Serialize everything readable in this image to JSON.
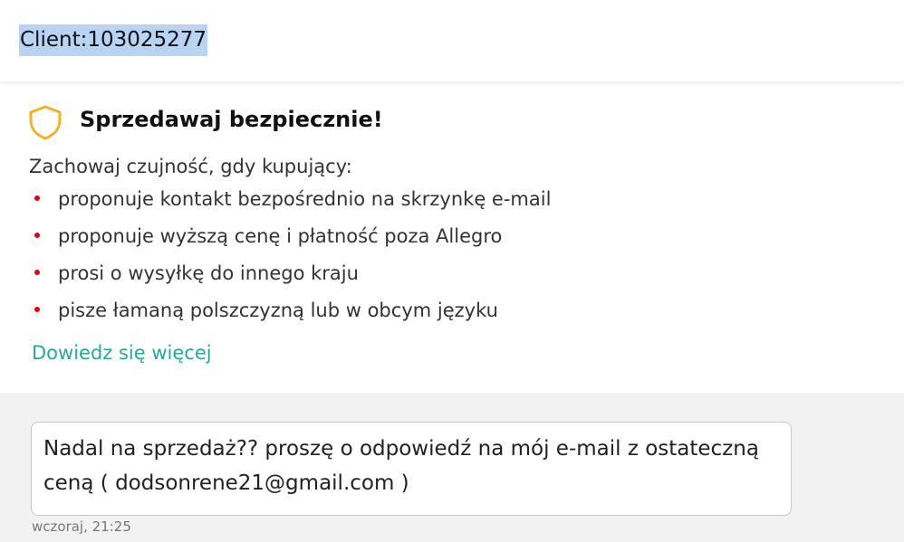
{
  "header": {
    "client_label": "Client:103025277"
  },
  "safety_card": {
    "icon": "shield-icon",
    "title": "Sprzedawaj bezpiecznie!",
    "intro": "Zachowaj czujność, gdy kupujący:",
    "items": [
      "proponuje kontakt bezpośrednio na skrzynkę e-mail",
      "proponuje wyższą cenę i płatność poza Allegro",
      "prosi o wysyłkę do innego kraju",
      "pisze łamaną polszczyzną lub w obcym języku"
    ],
    "learn_more": "Dowiedz się więcej"
  },
  "message": {
    "text": "Nadal na sprzedaż?? proszę o odpowiedź na mój e-mail z ostateczną ceną ( dodsonrene21@gmail.com )",
    "timestamp": "wczoraj, 21:25"
  },
  "colors": {
    "accent_link": "#2aa79b",
    "bullet": "#e3001b",
    "shield": "#f0b323",
    "selection_highlight": "#b9d4f3",
    "conversation_bg": "#f2f2f2"
  }
}
